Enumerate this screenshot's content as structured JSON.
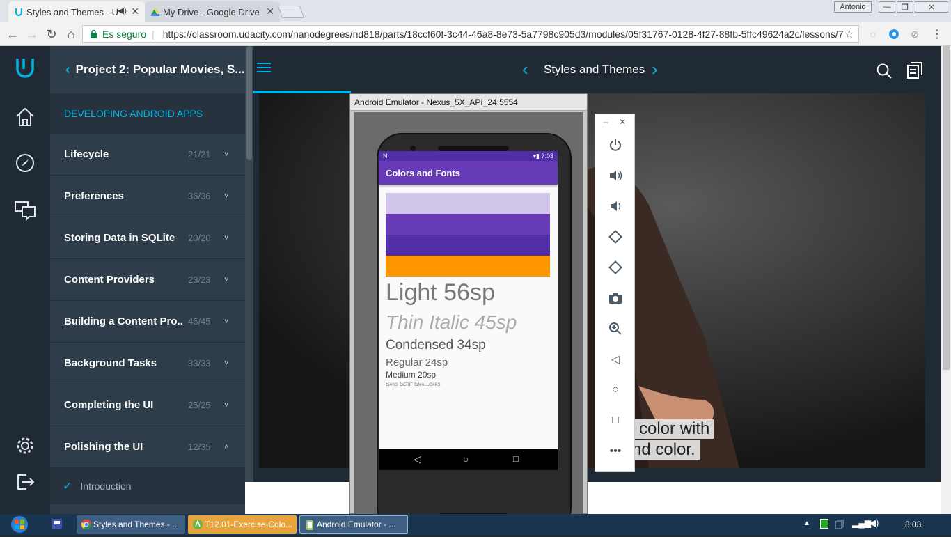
{
  "browser": {
    "tabs": [
      {
        "title": "Styles and Themes - U",
        "active": true
      },
      {
        "title": "My Drive - Google Drive",
        "active": false
      }
    ],
    "profile": "Antonio",
    "secure_label": "Es seguro",
    "url": "https://classroom.udacity.com/nanodegrees/nd818/parts/18ccf60f-3c44-46a8-8e73-5a7798c905d3/modules/05f31767-0128-4f27-88fb-5ffc49624a2c/lessons/7"
  },
  "sidebar": {
    "back_title": "Project 2: Popular Movies, S...",
    "section": "DEVELOPING ANDROID APPS",
    "lessons": [
      {
        "title": "Lifecycle",
        "count": "21/21",
        "chevron": "˅"
      },
      {
        "title": "Preferences",
        "count": "36/36",
        "chevron": "˅"
      },
      {
        "title": "Storing Data in SQLite",
        "count": "20/20",
        "chevron": "˅"
      },
      {
        "title": "Content Providers",
        "count": "23/23",
        "chevron": "˅"
      },
      {
        "title": "Building a Content Pro...",
        "count": "45/45",
        "chevron": "˅"
      },
      {
        "title": "Background Tasks",
        "count": "33/33",
        "chevron": "˅"
      },
      {
        "title": "Completing the UI",
        "count": "25/25",
        "chevron": "˅"
      },
      {
        "title": "Polishing the UI",
        "count": "12/35",
        "chevron": "˄"
      }
    ],
    "concept": "Introduction"
  },
  "header": {
    "title": "Styles and Themes"
  },
  "emulator": {
    "window_title": "Android Emulator - Nexus_5X_API_24:5554",
    "status_time": "7:03",
    "app_title": "Colors and Fonts",
    "swatches": [
      "#d1c4e9",
      "#673ab7",
      "#512da8",
      "#ff9800"
    ],
    "samples": [
      "Light 56sp",
      "Thin Italic 45sp",
      "Condensed 34sp",
      "Regular 24sp",
      "Medium 20sp",
      "Sans Serif Smallcaps"
    ]
  },
  "video": {
    "caption_line1": "color with",
    "caption_line2": "nd color."
  },
  "taskbar": {
    "items": [
      {
        "label": "Styles and Themes - ..."
      },
      {
        "label": "T12.01-Exercise-Colo..."
      },
      {
        "label": "Android Emulator - ..."
      }
    ],
    "clock": "8:03"
  },
  "colors": {
    "udacity_blue": "#02b3e4",
    "sidebar_bg": "#2e3d49",
    "rail_bg": "#1f2a35"
  }
}
